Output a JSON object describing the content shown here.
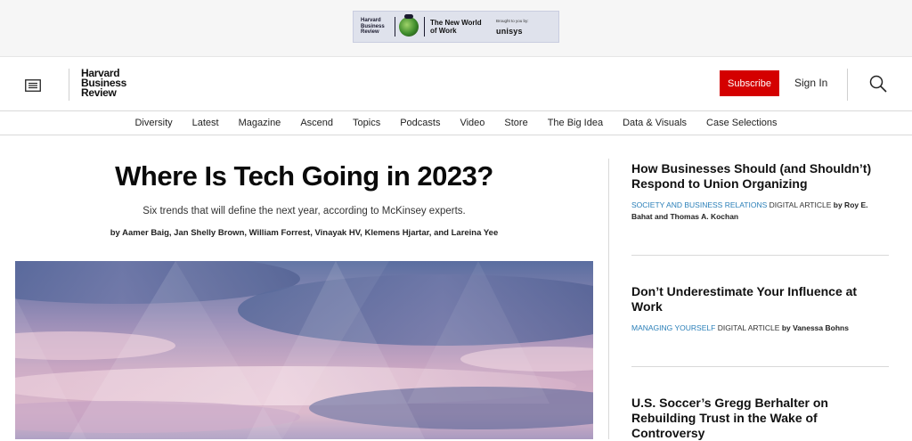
{
  "ad": {
    "brand_lines": [
      "Harvard",
      "Business",
      "Review"
    ],
    "title": "The New World of Work",
    "brought_to_you_by": "Brought to you by:",
    "sponsor": "unisys"
  },
  "header": {
    "logo_lines": [
      "Harvard",
      "Business",
      "Review"
    ],
    "subscribe_label": "Subscribe",
    "signin_label": "Sign In",
    "accent_color": "#d40000"
  },
  "nav": {
    "items": [
      "Diversity",
      "Latest",
      "Magazine",
      "Ascend",
      "Topics",
      "Podcasts",
      "Video",
      "Store",
      "The Big Idea",
      "Data & Visuals",
      "Case Selections"
    ]
  },
  "article": {
    "headline": "Where Is Tech Going in 2023?",
    "dek": "Six trends that will define the next year, according to McKinsey experts.",
    "byline": "by Aamer Baig, Jan Shelly Brown, William Forrest, Vinayak HV, Klemens Hjartar, and Lareina Yee"
  },
  "sidebar": {
    "items": [
      {
        "title": "How Businesses Should (and Shouldn’t) Respond to Union Organizing",
        "topic": "SOCIETY AND BUSINESS RELATIONS",
        "type": "DIGITAL ARTICLE",
        "byline": "by Roy E. Bahat and Thomas A. Kochan"
      },
      {
        "title": "Don’t Underestimate Your Influence at Work",
        "topic": "MANAGING YOURSELF",
        "type": "DIGITAL ARTICLE",
        "byline": "by Vanessa Bohns"
      },
      {
        "title": "U.S. Soccer’s Gregg Berhalter on Rebuilding Trust in the Wake of Controversy"
      }
    ],
    "topic_color": "#2a7fb8"
  },
  "icons": {
    "menu": "menu-icon",
    "search": "search-icon"
  }
}
